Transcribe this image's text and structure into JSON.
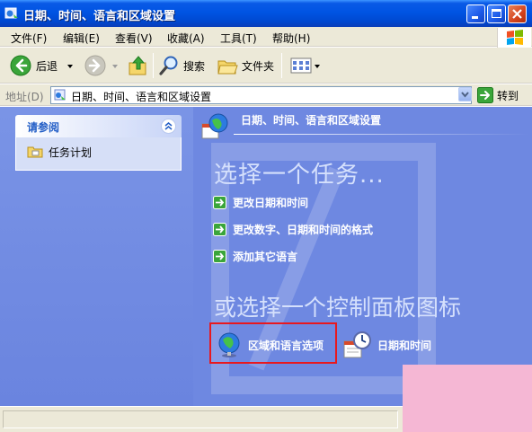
{
  "window": {
    "title": "日期、时间、语言和区域设置"
  },
  "menu": {
    "items": [
      "文件(F)",
      "编辑(E)",
      "查看(V)",
      "收藏(A)",
      "工具(T)",
      "帮助(H)"
    ]
  },
  "toolbar": {
    "back_label": "后退",
    "search_label": "搜索",
    "folders_label": "文件夹"
  },
  "address": {
    "label": "地址(D)",
    "value": "日期、时间、语言和区域设置",
    "go_label": "转到"
  },
  "sidebar": {
    "panel_title": "请参阅",
    "links": [
      "任务计划"
    ]
  },
  "main": {
    "header_title": "日期、时间、语言和区域设置",
    "pick_task_heading": "选择一个任务...",
    "tasks": [
      "更改日期和时间",
      "更改数字、日期和时间的格式",
      "添加其它语言"
    ],
    "pick_icon_heading": "或选择一个控制面板图标",
    "control_panel_icons": [
      "区域和语言选项",
      "日期和时间"
    ]
  },
  "colors": {
    "titlebar": "#0054e3",
    "content_background": "#6e88e1",
    "highlight_border": "#e8181e",
    "overlay_pink": "#f5b7d4"
  }
}
